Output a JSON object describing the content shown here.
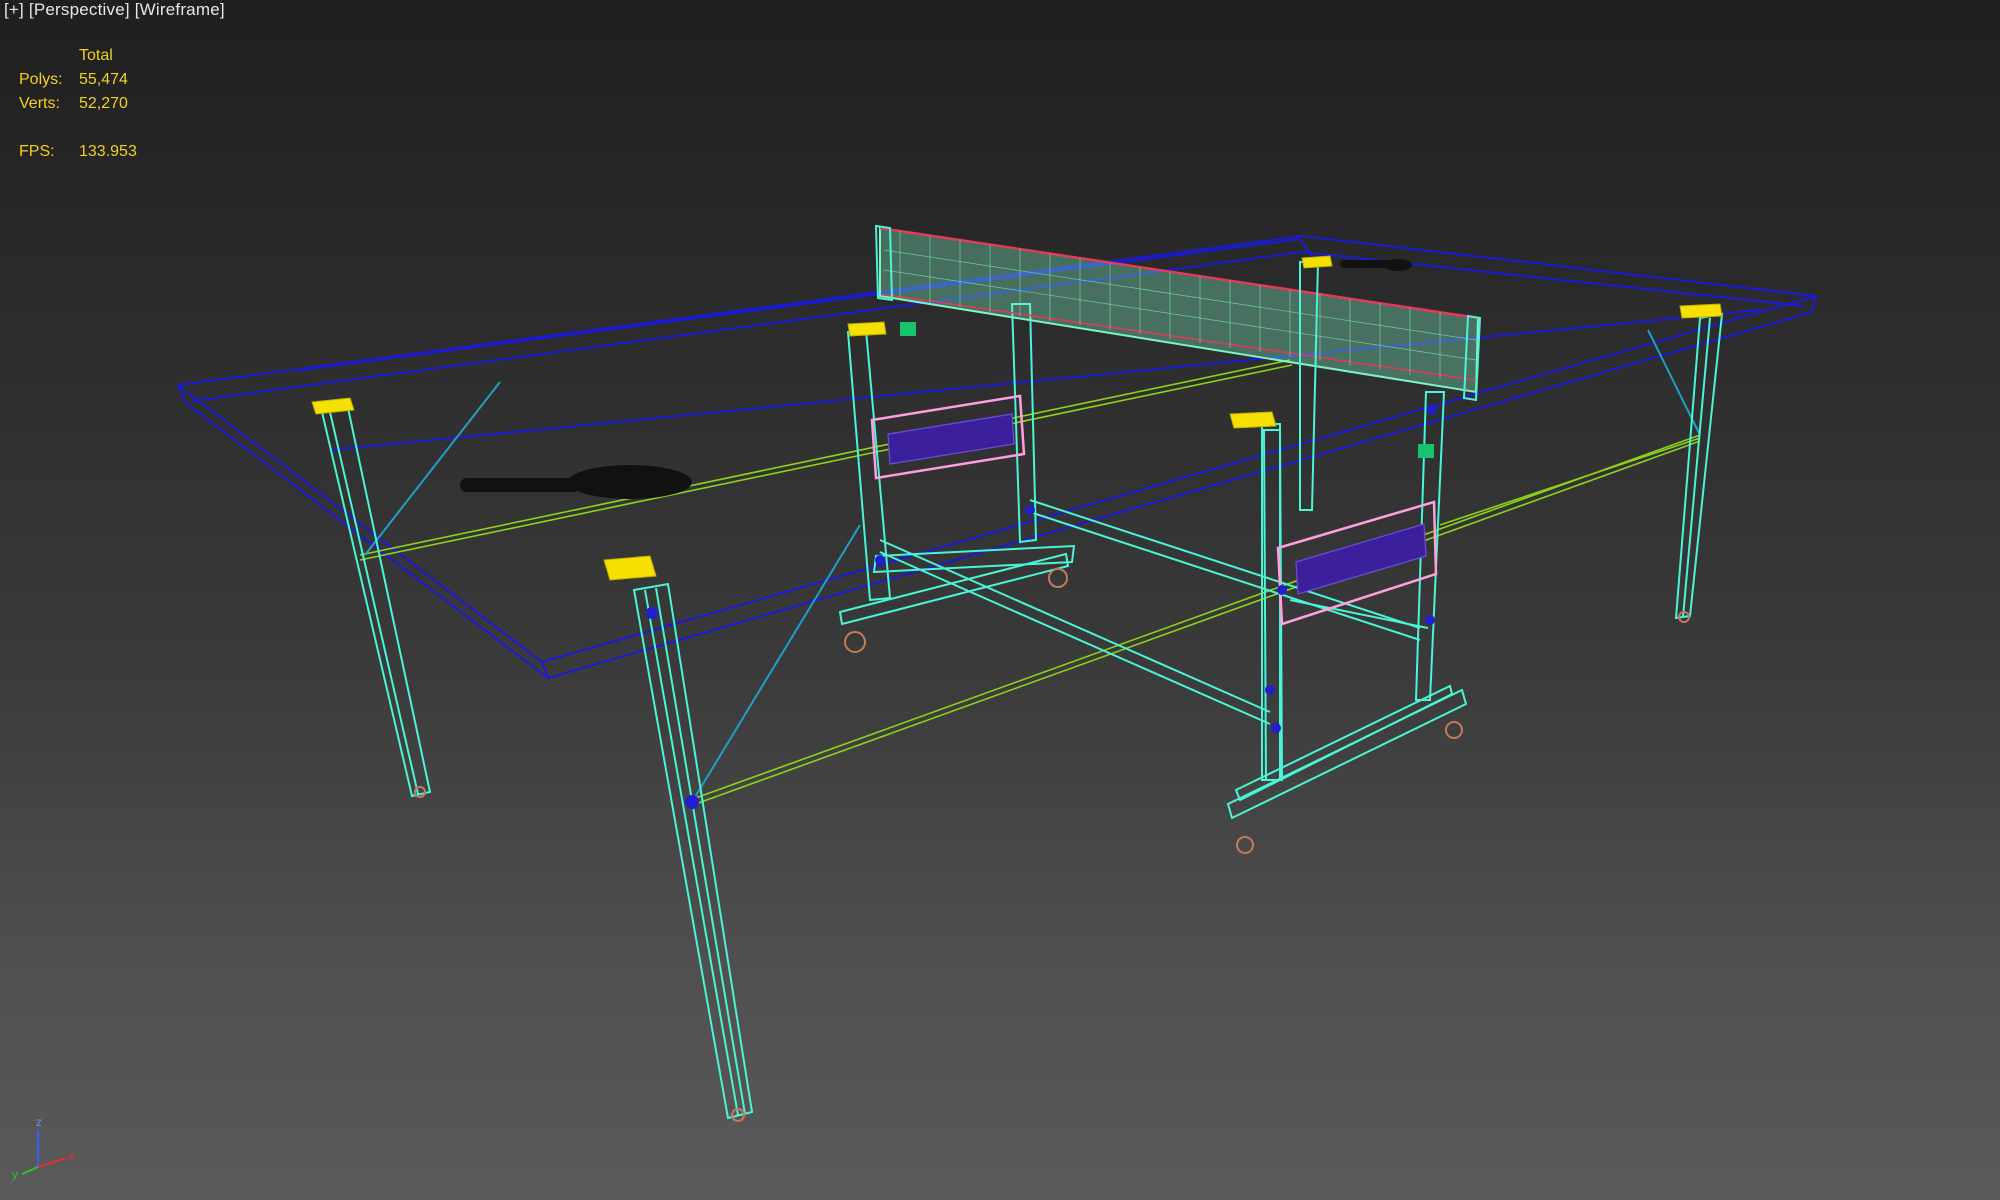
{
  "viewport": {
    "labels": {
      "plus": "[+]",
      "view": "[Perspective]",
      "shading": "[Wireframe]"
    },
    "stats": {
      "header": "Total",
      "polys_label": "Polys:",
      "polys_value": "55,474",
      "verts_label": "Verts:",
      "verts_value": "52,270",
      "fps_label": "FPS:",
      "fps_value": "133.953"
    },
    "gizmo": {
      "x": "x",
      "y": "y",
      "z": "z"
    },
    "colors": {
      "tabletop": "#1a1ad8",
      "frame": "#49f5d5",
      "bracket": "#f5e000",
      "net_border": "#e23a5a",
      "net_mesh": "#7ef2c4",
      "support_rail": "#8cd21a",
      "panel": "#ff9fe0",
      "brace": "#1f9fc8",
      "paddle": "#111111",
      "wheel": "#c47a5a"
    }
  }
}
